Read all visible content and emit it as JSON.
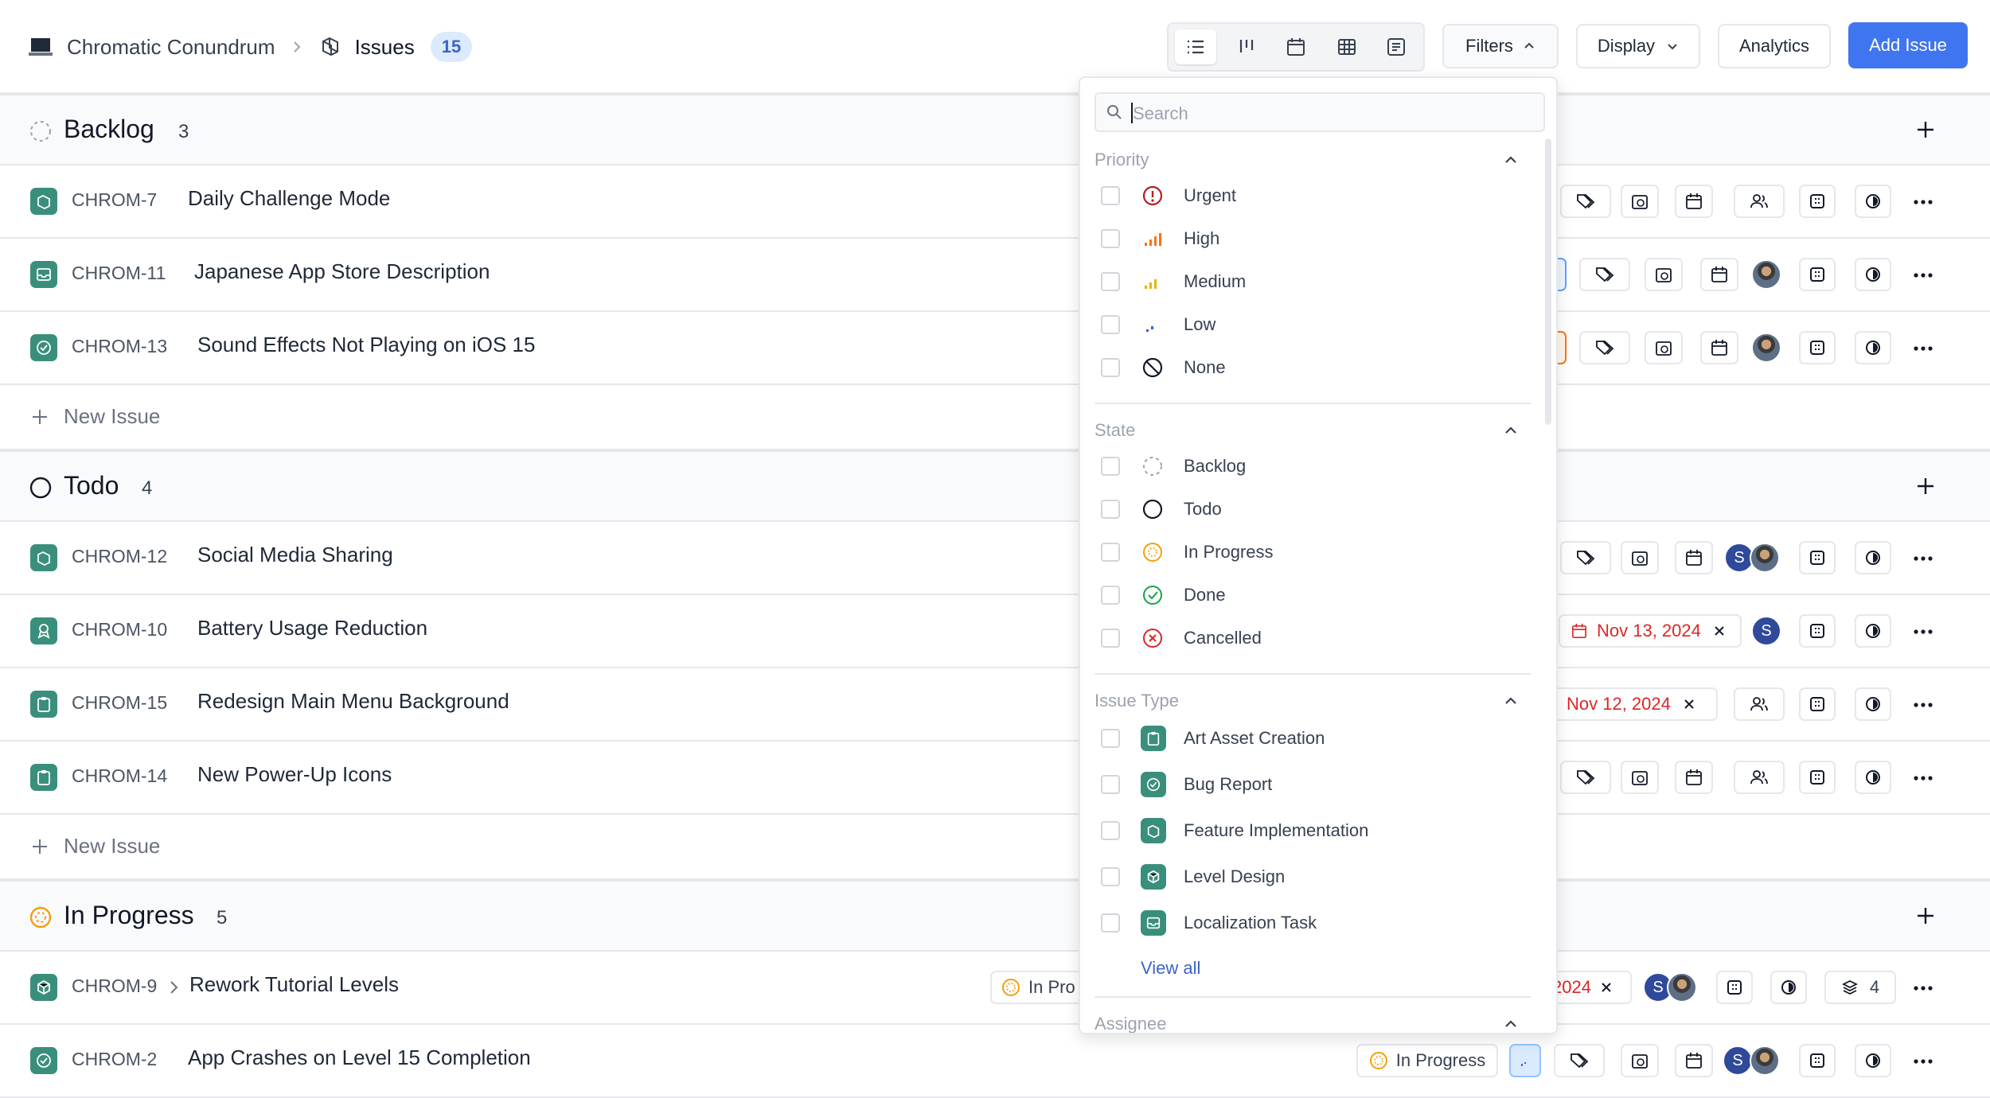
{
  "header": {
    "project": "Chromatic Conundrum",
    "section": "Issues",
    "count": "15",
    "filters": "Filters",
    "display": "Display",
    "analytics": "Analytics",
    "add": "Add Issue"
  },
  "groups": [
    {
      "title": "Backlog",
      "count": "3"
    },
    {
      "title": "Todo",
      "count": "4"
    },
    {
      "title": "In Progress",
      "count": "5"
    }
  ],
  "rows": [
    {
      "id": "CHROM-7",
      "title": "Daily Challenge Mode",
      "type": "feature"
    },
    {
      "id": "CHROM-11",
      "title": "Japanese App Store Description",
      "type": "localization"
    },
    {
      "id": "CHROM-13",
      "title": "Sound Effects Not Playing on iOS 15",
      "type": "bug"
    },
    {
      "id": "CHROM-12",
      "title": "Social Media Sharing",
      "type": "feature"
    },
    {
      "id": "CHROM-10",
      "title": "Battery Usage Reduction",
      "type": "optimization",
      "date": "Nov 13, 2024"
    },
    {
      "id": "CHROM-15",
      "title": "Redesign Main Menu Background",
      "type": "art",
      "date": "Nov 12, 2024"
    },
    {
      "id": "CHROM-14",
      "title": "New Power-Up Icons",
      "type": "art"
    },
    {
      "id": "CHROM-9",
      "title": "Rework Tutorial Levels",
      "type": "level",
      "state": "In Pro",
      "date": "2024",
      "subcount": "4"
    },
    {
      "id": "CHROM-2",
      "title": "App Crashes on Level 15 Completion",
      "type": "bug",
      "state": "In Progress"
    }
  ],
  "new_issue": "New Issue",
  "filter_panel": {
    "search_placeholder": "Search",
    "priority": {
      "label": "Priority",
      "options": [
        "Urgent",
        "High",
        "Medium",
        "Low",
        "None"
      ]
    },
    "state": {
      "label": "State",
      "options": [
        "Backlog",
        "Todo",
        "In Progress",
        "Done",
        "Cancelled"
      ]
    },
    "issue_type": {
      "label": "Issue Type",
      "options": [
        "Art Asset Creation",
        "Bug Report",
        "Feature Implementation",
        "Level Design",
        "Localization Task"
      ]
    },
    "view_all": "View all",
    "assignee": {
      "label": "Assignee"
    }
  },
  "colors": {
    "accent": "#3f76ef",
    "type_icon": "#3a8f7c",
    "urgent": "#dc2626",
    "high": "#f97316",
    "low": "#3b63c9",
    "in_progress": "#f59e0b",
    "done": "#16a34a",
    "date": "#dc2626"
  }
}
